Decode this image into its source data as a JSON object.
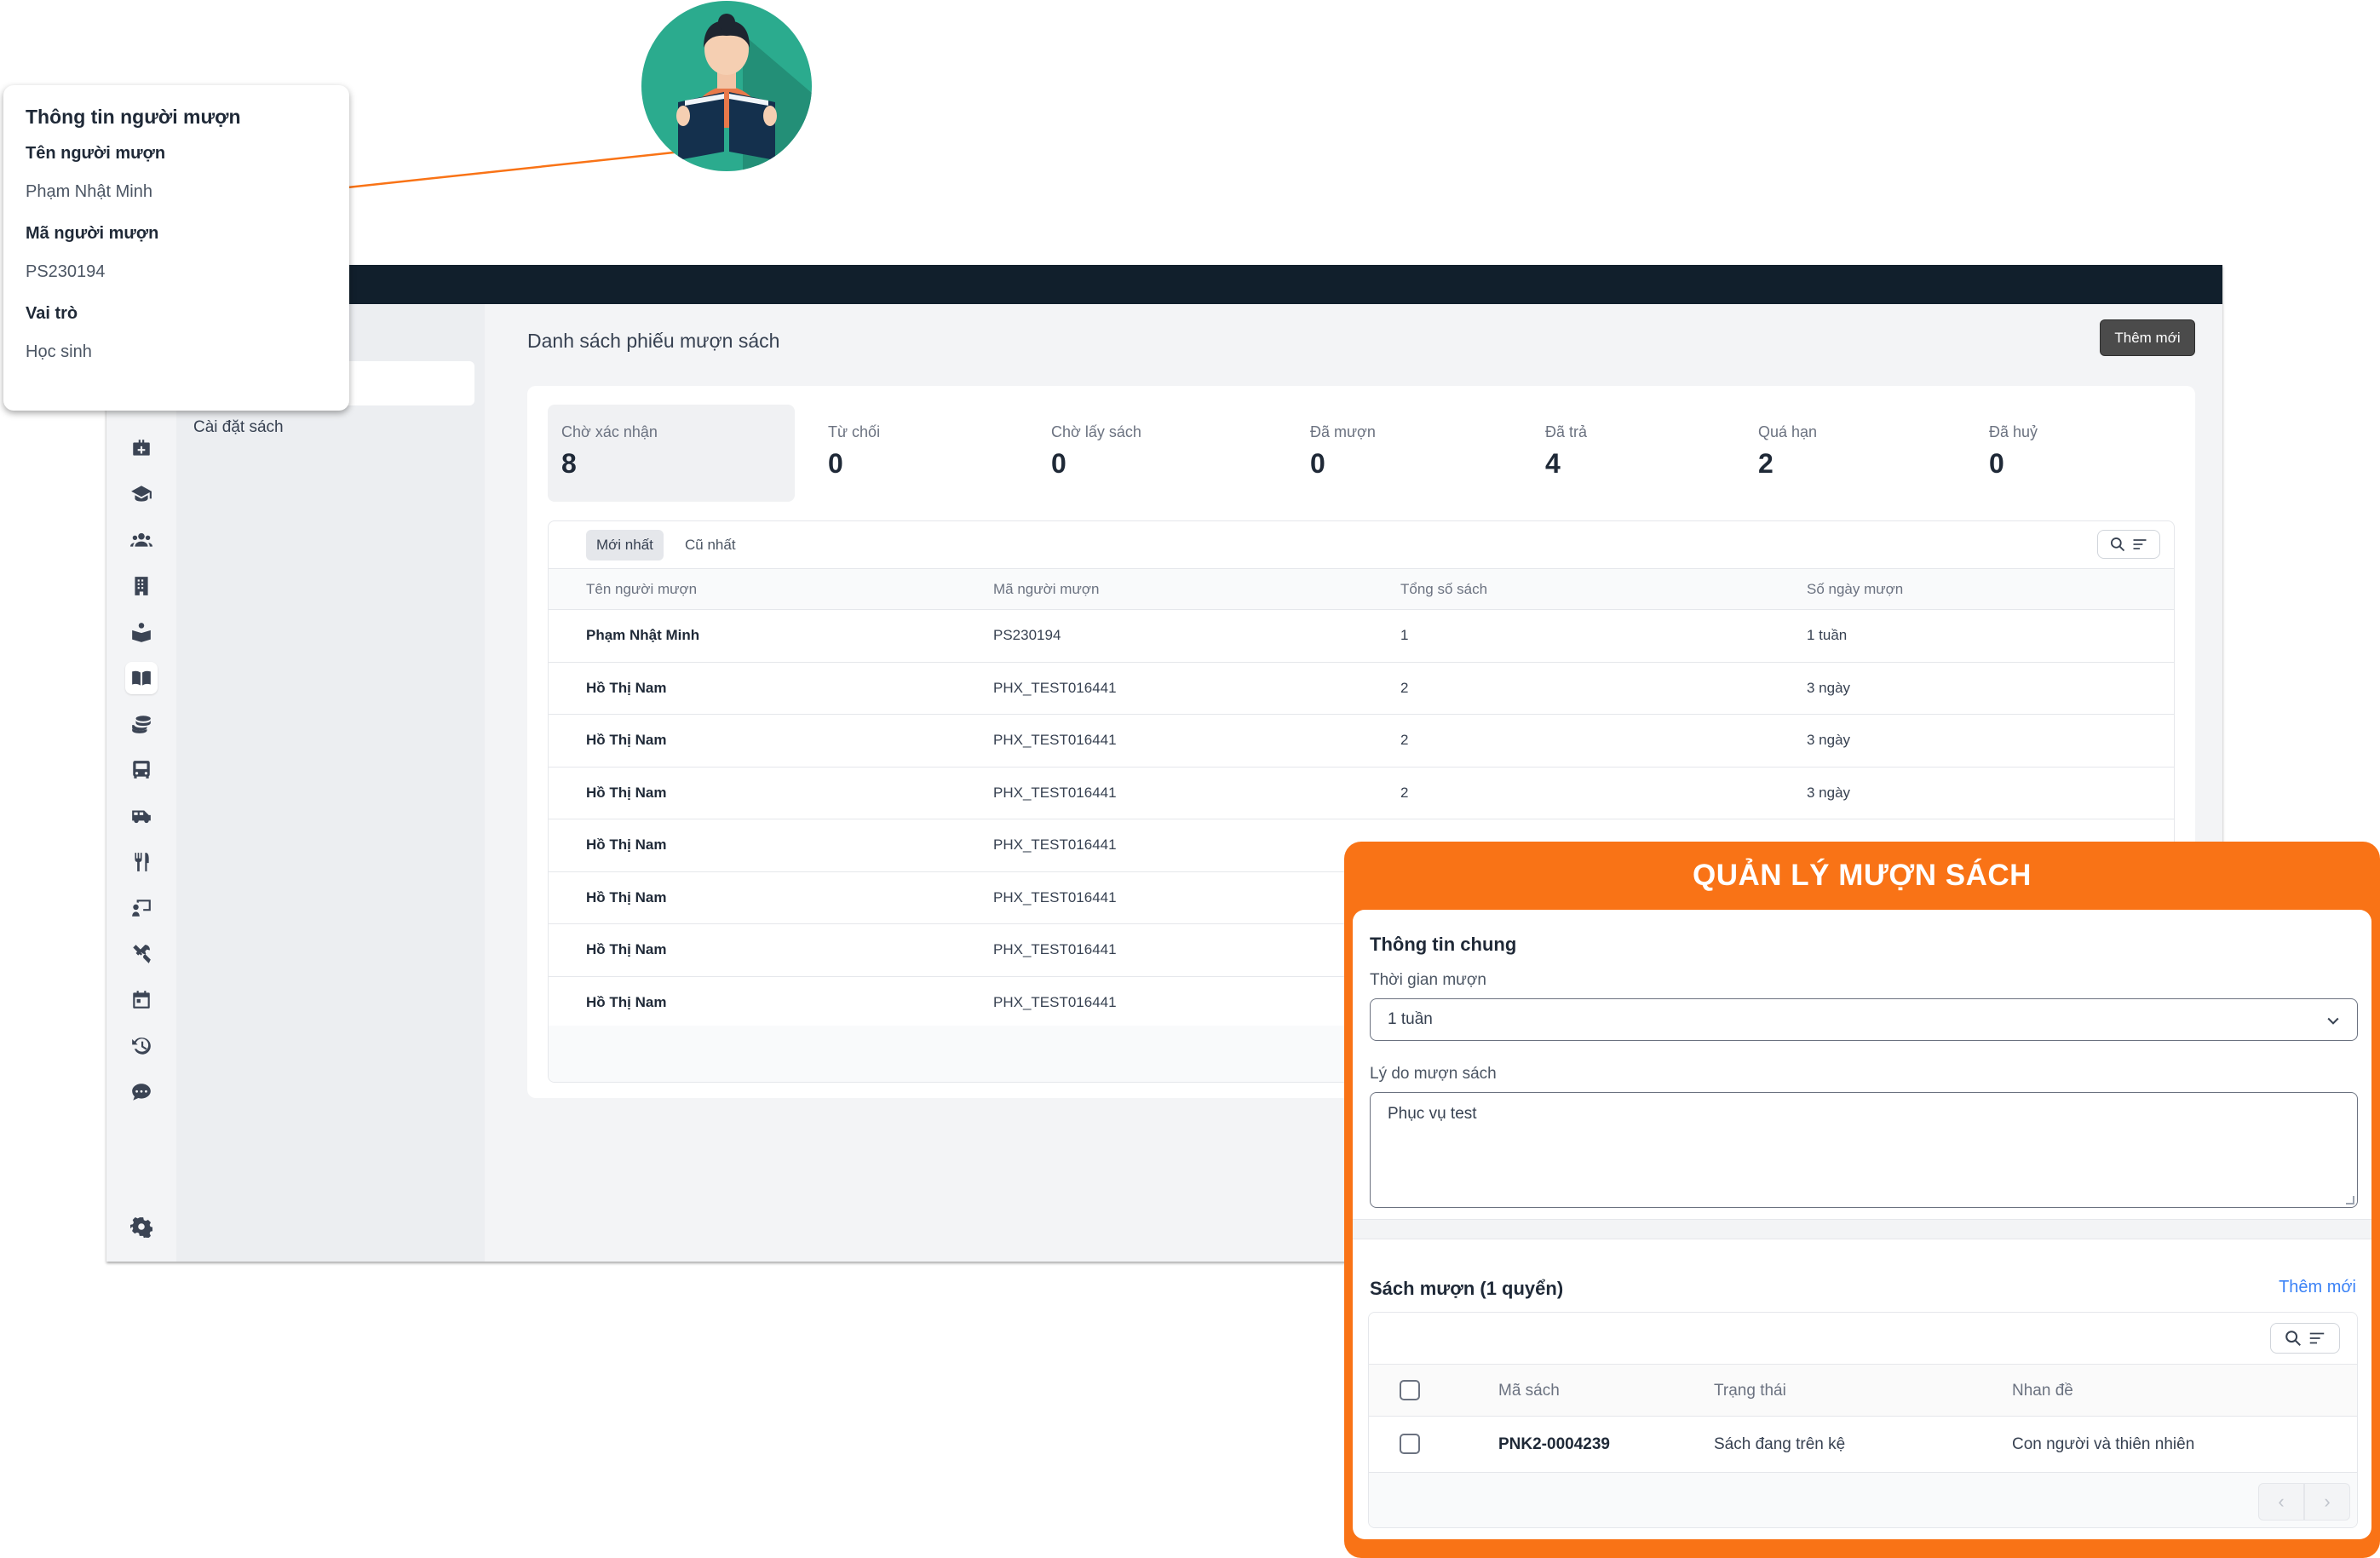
{
  "borrower_card": {
    "title": "Thông tin người mượn",
    "name_label": "Tên người mượn",
    "name_value": "Phạm Nhật Minh",
    "id_label": "Mã người mượn",
    "id_value": "PS230194",
    "role_label": "Vai trò",
    "role_value": "Học sinh"
  },
  "sidebar": {
    "icons": [
      "medical-kit-icon",
      "graduation-cap-icon",
      "users-icon",
      "building-icon",
      "reader-icon",
      "open-book-icon",
      "coins-icon",
      "bus-icon",
      "van-icon",
      "utensils-icon",
      "teacher-board-icon",
      "tools-icon",
      "calendar-icon",
      "history-icon",
      "chat-icon",
      "settings-icon"
    ],
    "active_icon": "open-book-icon",
    "subnav_item": "Cài đặt sách"
  },
  "main": {
    "title": "Danh sách phiếu mượn sách",
    "add_button": "Thêm mới",
    "stats": [
      {
        "label": "Chờ xác nhận",
        "value": "8"
      },
      {
        "label": "Từ chối",
        "value": "0"
      },
      {
        "label": "Chờ lấy sách",
        "value": "0"
      },
      {
        "label": "Đã mượn",
        "value": "0"
      },
      {
        "label": "Đã trả",
        "value": "4"
      },
      {
        "label": "Quá hạn",
        "value": "2"
      },
      {
        "label": "Đã huỷ",
        "value": "0"
      }
    ],
    "sort_tabs": [
      "Mới nhất",
      "Cũ nhất"
    ],
    "columns": [
      "Tên người mượn",
      "Mã người mượn",
      "Tổng số sách",
      "Số ngày mượn"
    ],
    "rows": [
      [
        "Phạm Nhật Minh",
        "PS230194",
        "1",
        "1 tuần"
      ],
      [
        "Hồ Thị Nam",
        "PHX_TEST016441",
        "2",
        "3 ngày"
      ],
      [
        "Hồ Thị Nam",
        "PHX_TEST016441",
        "2",
        "3 ngày"
      ],
      [
        "Hồ Thị Nam",
        "PHX_TEST016441",
        "2",
        "3 ngày"
      ],
      [
        "Hồ Thị Nam",
        "PHX_TEST016441",
        "",
        ""
      ],
      [
        "Hồ Thị Nam",
        "PHX_TEST016441",
        "",
        ""
      ],
      [
        "Hồ Thị Nam",
        "PHX_TEST016441",
        "",
        ""
      ],
      [
        "Hồ Thị Nam",
        "PHX_TEST016441",
        "",
        ""
      ]
    ]
  },
  "panel": {
    "title": "QUẢN LÝ MƯỢN SÁCH",
    "section_general": "Thông tin chung",
    "duration_label": "Thời gian mượn",
    "duration_value": "1 tuần",
    "reason_label": "Lý do mượn sách",
    "reason_value": "Phục vụ test",
    "books_title": "Sách mượn (1 quyển)",
    "add_link": "Thêm mới",
    "book_columns": [
      "Mã sách",
      "Trạng thái",
      "Nhan đề"
    ],
    "books": [
      {
        "code": "PNK2-0004239",
        "status": "Sách đang trên kệ",
        "title": "Con người và thiên nhiên"
      }
    ]
  },
  "colors": {
    "topbar": "#111f2c",
    "accent_orange": "#f97316",
    "link_blue": "#3b82f6",
    "button_dark": "#4b4b4b"
  }
}
